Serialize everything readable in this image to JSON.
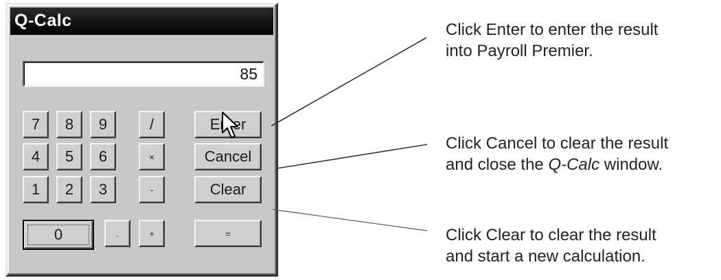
{
  "window": {
    "title": "Q-Calc"
  },
  "display": {
    "value": "85"
  },
  "keys": {
    "k7": "7",
    "k8": "8",
    "k9": "9",
    "div": "/",
    "k4": "4",
    "k5": "5",
    "k6": "6",
    "mul": "×",
    "k1": "1",
    "k2": "2",
    "k3": "3",
    "sub": "-",
    "k0": "0",
    "dot": ".",
    "add": "+"
  },
  "actions": {
    "enter": "Enter",
    "cancel": "Cancel",
    "clear": "Clear",
    "equals": "="
  },
  "captions": {
    "enter_line1": "Click Enter to enter the result",
    "enter_line2": "into Payroll Premier.",
    "cancel_line1": "Click Cancel to clear the result",
    "cancel_line2_a": "and close the ",
    "cancel_line2_italic": "Q-Calc",
    "cancel_line2_b": " window.",
    "clear_line1": "Click Clear to clear the result",
    "clear_line2": "and start a new calculation."
  },
  "colors": {
    "window_face": "#c8c8c8",
    "titlebar": "#000000",
    "title_text": "#ffffff"
  },
  "icons": {
    "pointer": "arrow-cursor-icon"
  }
}
